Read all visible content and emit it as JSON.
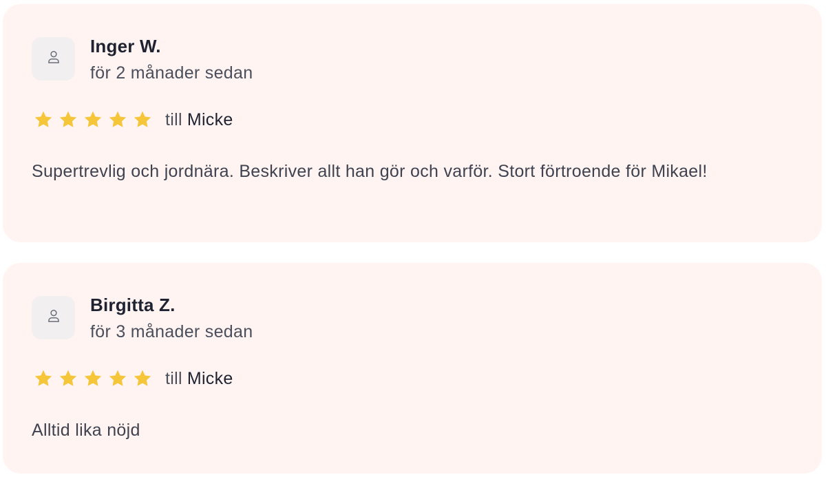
{
  "reviews": [
    {
      "author": "Inger W.",
      "date": "för 2 månader sedan",
      "rating": 5,
      "recipient_prefix": "till",
      "recipient": "Micke",
      "text": "Supertrevlig och jordnära. Beskriver allt han gör och varför. Stort förtroende för Mikael!",
      "avatar_icon": "person-outline-icon"
    },
    {
      "author": "Birgitta Z.",
      "date": "för 3 månader sedan",
      "rating": 5,
      "recipient_prefix": "till",
      "recipient": "Micke",
      "text": "Alltid lika nöjd",
      "avatar_icon": "person-outline-icon"
    }
  ],
  "colors": {
    "card_background": "#fff4f2",
    "star": "#f5c53a",
    "avatar_background": "#f1efef"
  }
}
